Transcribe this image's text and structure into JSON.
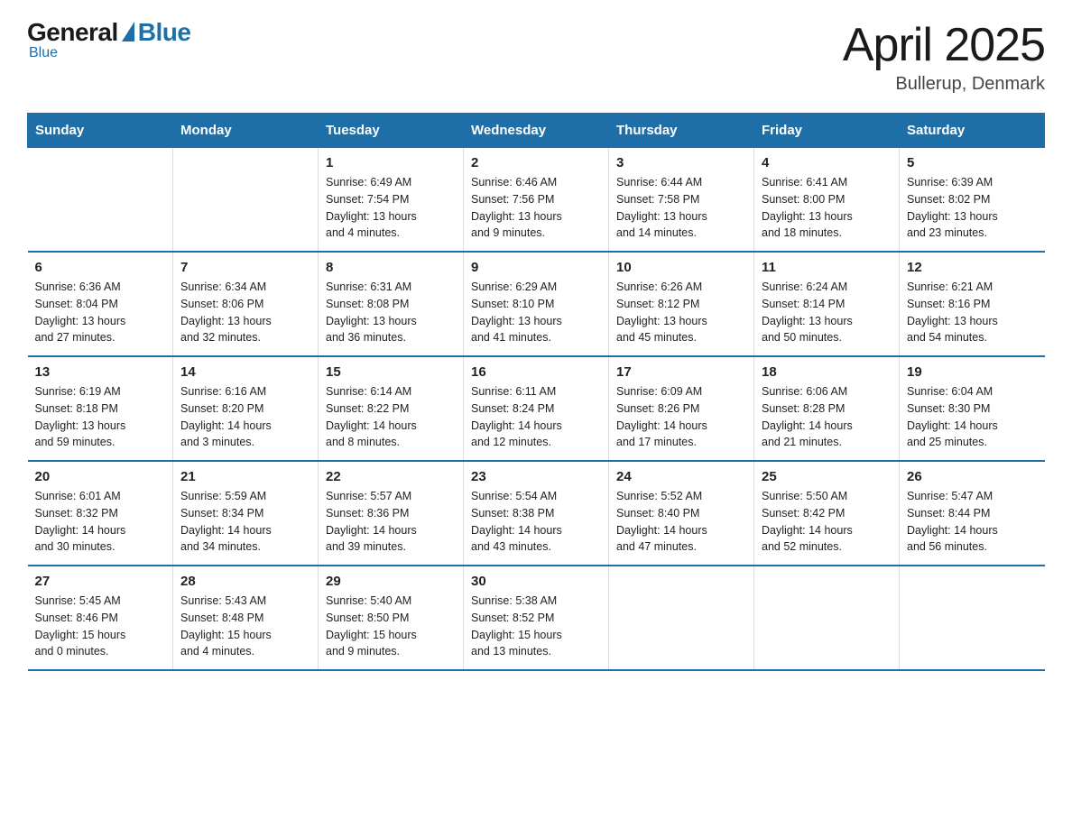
{
  "logo": {
    "general": "General",
    "blue": "Blue",
    "line2": "Blue"
  },
  "header": {
    "title": "April 2025",
    "subtitle": "Bullerup, Denmark"
  },
  "days_of_week": [
    "Sunday",
    "Monday",
    "Tuesday",
    "Wednesday",
    "Thursday",
    "Friday",
    "Saturday"
  ],
  "weeks": [
    [
      {
        "day": "",
        "info": ""
      },
      {
        "day": "",
        "info": ""
      },
      {
        "day": "1",
        "info": "Sunrise: 6:49 AM\nSunset: 7:54 PM\nDaylight: 13 hours\nand 4 minutes."
      },
      {
        "day": "2",
        "info": "Sunrise: 6:46 AM\nSunset: 7:56 PM\nDaylight: 13 hours\nand 9 minutes."
      },
      {
        "day": "3",
        "info": "Sunrise: 6:44 AM\nSunset: 7:58 PM\nDaylight: 13 hours\nand 14 minutes."
      },
      {
        "day": "4",
        "info": "Sunrise: 6:41 AM\nSunset: 8:00 PM\nDaylight: 13 hours\nand 18 minutes."
      },
      {
        "day": "5",
        "info": "Sunrise: 6:39 AM\nSunset: 8:02 PM\nDaylight: 13 hours\nand 23 minutes."
      }
    ],
    [
      {
        "day": "6",
        "info": "Sunrise: 6:36 AM\nSunset: 8:04 PM\nDaylight: 13 hours\nand 27 minutes."
      },
      {
        "day": "7",
        "info": "Sunrise: 6:34 AM\nSunset: 8:06 PM\nDaylight: 13 hours\nand 32 minutes."
      },
      {
        "day": "8",
        "info": "Sunrise: 6:31 AM\nSunset: 8:08 PM\nDaylight: 13 hours\nand 36 minutes."
      },
      {
        "day": "9",
        "info": "Sunrise: 6:29 AM\nSunset: 8:10 PM\nDaylight: 13 hours\nand 41 minutes."
      },
      {
        "day": "10",
        "info": "Sunrise: 6:26 AM\nSunset: 8:12 PM\nDaylight: 13 hours\nand 45 minutes."
      },
      {
        "day": "11",
        "info": "Sunrise: 6:24 AM\nSunset: 8:14 PM\nDaylight: 13 hours\nand 50 minutes."
      },
      {
        "day": "12",
        "info": "Sunrise: 6:21 AM\nSunset: 8:16 PM\nDaylight: 13 hours\nand 54 minutes."
      }
    ],
    [
      {
        "day": "13",
        "info": "Sunrise: 6:19 AM\nSunset: 8:18 PM\nDaylight: 13 hours\nand 59 minutes."
      },
      {
        "day": "14",
        "info": "Sunrise: 6:16 AM\nSunset: 8:20 PM\nDaylight: 14 hours\nand 3 minutes."
      },
      {
        "day": "15",
        "info": "Sunrise: 6:14 AM\nSunset: 8:22 PM\nDaylight: 14 hours\nand 8 minutes."
      },
      {
        "day": "16",
        "info": "Sunrise: 6:11 AM\nSunset: 8:24 PM\nDaylight: 14 hours\nand 12 minutes."
      },
      {
        "day": "17",
        "info": "Sunrise: 6:09 AM\nSunset: 8:26 PM\nDaylight: 14 hours\nand 17 minutes."
      },
      {
        "day": "18",
        "info": "Sunrise: 6:06 AM\nSunset: 8:28 PM\nDaylight: 14 hours\nand 21 minutes."
      },
      {
        "day": "19",
        "info": "Sunrise: 6:04 AM\nSunset: 8:30 PM\nDaylight: 14 hours\nand 25 minutes."
      }
    ],
    [
      {
        "day": "20",
        "info": "Sunrise: 6:01 AM\nSunset: 8:32 PM\nDaylight: 14 hours\nand 30 minutes."
      },
      {
        "day": "21",
        "info": "Sunrise: 5:59 AM\nSunset: 8:34 PM\nDaylight: 14 hours\nand 34 minutes."
      },
      {
        "day": "22",
        "info": "Sunrise: 5:57 AM\nSunset: 8:36 PM\nDaylight: 14 hours\nand 39 minutes."
      },
      {
        "day": "23",
        "info": "Sunrise: 5:54 AM\nSunset: 8:38 PM\nDaylight: 14 hours\nand 43 minutes."
      },
      {
        "day": "24",
        "info": "Sunrise: 5:52 AM\nSunset: 8:40 PM\nDaylight: 14 hours\nand 47 minutes."
      },
      {
        "day": "25",
        "info": "Sunrise: 5:50 AM\nSunset: 8:42 PM\nDaylight: 14 hours\nand 52 minutes."
      },
      {
        "day": "26",
        "info": "Sunrise: 5:47 AM\nSunset: 8:44 PM\nDaylight: 14 hours\nand 56 minutes."
      }
    ],
    [
      {
        "day": "27",
        "info": "Sunrise: 5:45 AM\nSunset: 8:46 PM\nDaylight: 15 hours\nand 0 minutes."
      },
      {
        "day": "28",
        "info": "Sunrise: 5:43 AM\nSunset: 8:48 PM\nDaylight: 15 hours\nand 4 minutes."
      },
      {
        "day": "29",
        "info": "Sunrise: 5:40 AM\nSunset: 8:50 PM\nDaylight: 15 hours\nand 9 minutes."
      },
      {
        "day": "30",
        "info": "Sunrise: 5:38 AM\nSunset: 8:52 PM\nDaylight: 15 hours\nand 13 minutes."
      },
      {
        "day": "",
        "info": ""
      },
      {
        "day": "",
        "info": ""
      },
      {
        "day": "",
        "info": ""
      }
    ]
  ]
}
